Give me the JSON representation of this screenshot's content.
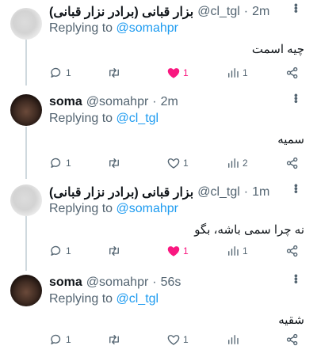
{
  "tweets": [
    {
      "name": "بزار قبانی (برادر نزار قبانی)",
      "handle": "@cl_tgl",
      "sep": "·",
      "time": "2m",
      "replying_prefix": "Replying to",
      "replying_handle": "@somahpr",
      "text": "چیه اسمت",
      "replies": "1",
      "retweets": "",
      "likes": "1",
      "views": "1",
      "liked": true,
      "avatar": "blurred"
    },
    {
      "name": "soma",
      "handle": "@somahpr",
      "sep": "·",
      "time": "2m",
      "replying_prefix": "Replying to",
      "replying_handle": "@cl_tgl",
      "text": "سمیه",
      "replies": "1",
      "retweets": "",
      "likes": "1",
      "views": "2",
      "liked": false,
      "avatar": "photo"
    },
    {
      "name": "بزار قبانی (برادر نزار قبانی)",
      "handle": "@cl_tgl",
      "sep": "·",
      "time": "1m",
      "replying_prefix": "Replying to",
      "replying_handle": "@somahpr",
      "text": "نه چرا سمی باشه، بگو",
      "replies": "1",
      "retweets": "",
      "likes": "1",
      "views": "1",
      "liked": true,
      "avatar": "blurred"
    },
    {
      "name": "soma",
      "handle": "@somahpr",
      "sep": "·",
      "time": "56s",
      "replying_prefix": "Replying to",
      "replying_handle": "@cl_tgl",
      "text": "شقیه",
      "replies": "1",
      "retweets": "",
      "likes": "1",
      "views": "",
      "liked": false,
      "avatar": "photo"
    }
  ],
  "colors": {
    "text": "#0f1419",
    "secondary": "#536471",
    "link": "#1d9bf0",
    "like_active": "#f91880",
    "thread_line": "#cfd9de"
  },
  "icons": [
    "reply-icon",
    "retweet-icon",
    "like-icon",
    "views-icon",
    "share-icon",
    "more-icon"
  ]
}
